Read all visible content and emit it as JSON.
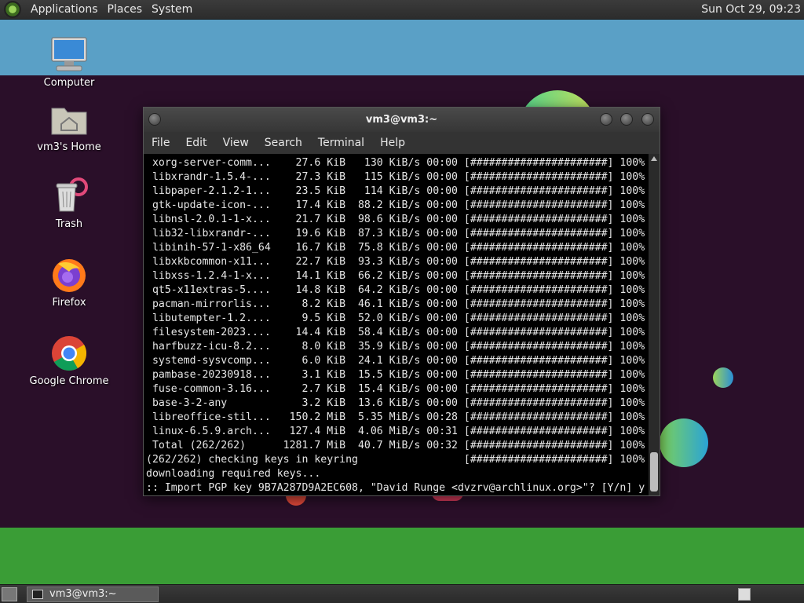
{
  "top_panel": {
    "menus": [
      "Applications",
      "Places",
      "System"
    ],
    "clock": "Sun Oct 29, 09:23"
  },
  "desktop_icons": [
    {
      "label": "Computer",
      "icon": "computer-icon"
    },
    {
      "label": "vm3's Home",
      "icon": "home-folder-icon"
    },
    {
      "label": "Trash",
      "icon": "trash-icon"
    },
    {
      "label": "Firefox",
      "icon": "firefox-icon"
    },
    {
      "label": "Google Chrome",
      "icon": "chrome-icon"
    }
  ],
  "terminal": {
    "title": "vm3@vm3:~",
    "menus": [
      "File",
      "Edit",
      "View",
      "Search",
      "Terminal",
      "Help"
    ],
    "lines": [
      " xorg-server-comm...    27.6 KiB   130 KiB/s 00:00 [######################] 100%",
      " libxrandr-1.5.4-...    27.3 KiB   115 KiB/s 00:00 [######################] 100%",
      " libpaper-2.1.2-1...    23.5 KiB   114 KiB/s 00:00 [######################] 100%",
      " gtk-update-icon-...    17.4 KiB  88.2 KiB/s 00:00 [######################] 100%",
      " libnsl-2.0.1-1-x...    21.7 KiB  98.6 KiB/s 00:00 [######################] 100%",
      " lib32-libxrandr-...    19.6 KiB  87.3 KiB/s 00:00 [######################] 100%",
      " libinih-57-1-x86_64    16.7 KiB  75.8 KiB/s 00:00 [######################] 100%",
      " libxkbcommon-x11...    22.7 KiB  93.3 KiB/s 00:00 [######################] 100%",
      " libxss-1.2.4-1-x...    14.1 KiB  66.2 KiB/s 00:00 [######################] 100%",
      " qt5-x11extras-5....    14.8 KiB  64.2 KiB/s 00:00 [######################] 100%",
      " pacman-mirrorlis...     8.2 KiB  46.1 KiB/s 00:00 [######################] 100%",
      " libutempter-1.2....     9.5 KiB  52.0 KiB/s 00:00 [######################] 100%",
      " filesystem-2023....    14.4 KiB  58.4 KiB/s 00:00 [######################] 100%",
      " harfbuzz-icu-8.2...     8.0 KiB  35.9 KiB/s 00:00 [######################] 100%",
      " systemd-sysvcomp...     6.0 KiB  24.1 KiB/s 00:00 [######################] 100%",
      " pambase-20230918...     3.1 KiB  15.5 KiB/s 00:00 [######################] 100%",
      " fuse-common-3.16...     2.7 KiB  15.4 KiB/s 00:00 [######################] 100%",
      " base-3-2-any            3.2 KiB  13.6 KiB/s 00:00 [######################] 100%",
      " libreoffice-stil...   150.2 MiB  5.35 MiB/s 00:28 [######################] 100%",
      " linux-6.5.9.arch...   127.4 MiB  4.06 MiB/s 00:31 [######################] 100%",
      " Total (262/262)      1281.7 MiB  40.7 MiB/s 00:32 [######################] 100%",
      "(262/262) checking keys in keyring                 [######################] 100%",
      "downloading required keys...",
      ":: Import PGP key 9B7A287D9A2EC608, \"David Runge <dvzrv@archlinux.org>\"? [Y/n] y"
    ]
  },
  "taskbar": {
    "items": [
      {
        "label": "vm3@vm3:~"
      }
    ]
  },
  "colors": {
    "sky": "#5aa0c6",
    "desktop_dark": "#2a0f29",
    "grass": "#3a9d36",
    "panel": "#333333",
    "terminal_bg": "#000000",
    "terminal_fg": "#e6e6e6"
  }
}
